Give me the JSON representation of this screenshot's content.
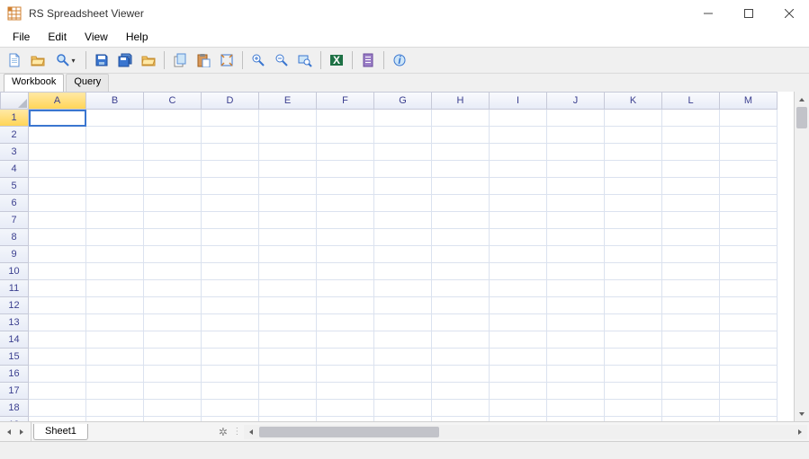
{
  "window": {
    "title": "RS Spreadsheet Viewer"
  },
  "menus": {
    "file": "File",
    "edit": "Edit",
    "view": "View",
    "help": "Help"
  },
  "tabs": {
    "workbook": "Workbook",
    "query": "Query"
  },
  "toolbar": {
    "icons": [
      "new-file",
      "open-folder",
      "find",
      "save",
      "save-all",
      "open-folder-2",
      "copy-sheet",
      "paste-sheet",
      "fit-window",
      "zoom-in",
      "zoom-out",
      "zoom-select",
      "excel",
      "report",
      "info"
    ]
  },
  "grid": {
    "columns": [
      "A",
      "B",
      "C",
      "D",
      "E",
      "F",
      "G",
      "H",
      "I",
      "J",
      "K",
      "L",
      "M"
    ],
    "row_count": 20,
    "active_cell": {
      "row": 1,
      "col": "A"
    }
  },
  "sheets": {
    "active": "Sheet1"
  }
}
